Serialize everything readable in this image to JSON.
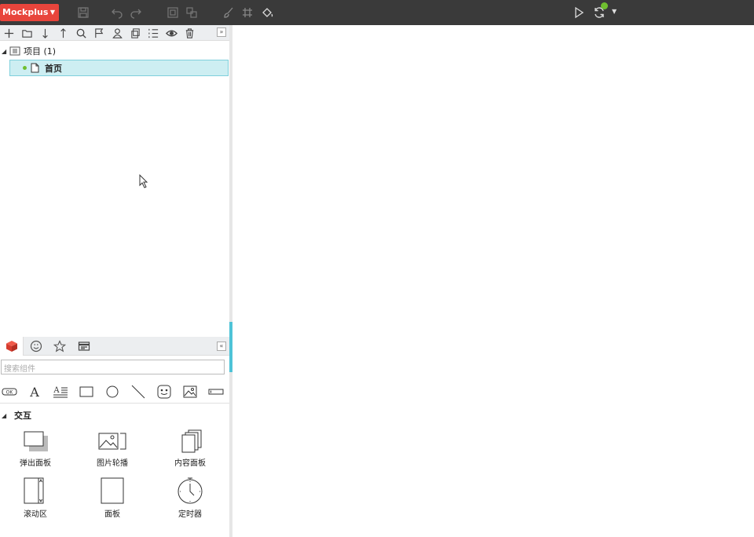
{
  "app": {
    "brand": "Mockplus"
  },
  "toolbar": {
    "icons": [
      "save-icon",
      "undo-icon",
      "redo-icon",
      "group-icon",
      "ungroup-icon",
      "brush-icon",
      "grid-icon",
      "paint-bucket-icon",
      "preview-play-icon",
      "sync-icon"
    ]
  },
  "pages_panel": {
    "toolbar_icons": [
      "add-icon",
      "folder-icon",
      "move-down-icon",
      "move-up-icon",
      "search-icon",
      "flag-icon",
      "user-icon",
      "copy-icon",
      "list-icon",
      "eye-icon",
      "trash-icon"
    ],
    "project": {
      "label": "项目 (1)"
    },
    "pages": [
      {
        "label": "首页",
        "selected": true
      }
    ]
  },
  "library": {
    "tabs": [
      "components-tab",
      "emoji-tab",
      "favorites-tab",
      "templates-tab"
    ],
    "search_placeholder": "搜索组件",
    "basic_components": [
      "ok-button",
      "text",
      "paragraph",
      "rectangle",
      "circle",
      "line",
      "smiley",
      "image",
      "input"
    ],
    "section": {
      "label": "交互"
    },
    "components": [
      {
        "label": "弹出面板"
      },
      {
        "label": "图片轮播"
      },
      {
        "label": "内容面板"
      },
      {
        "label": "滚动区"
      },
      {
        "label": "面板"
      },
      {
        "label": "定时器"
      }
    ]
  },
  "colors": {
    "brand": "#e8453c",
    "topbar": "#3a3a3a",
    "selection": "#cdeef2",
    "accent": "#4ec3d7",
    "online": "#6fbf2f"
  }
}
